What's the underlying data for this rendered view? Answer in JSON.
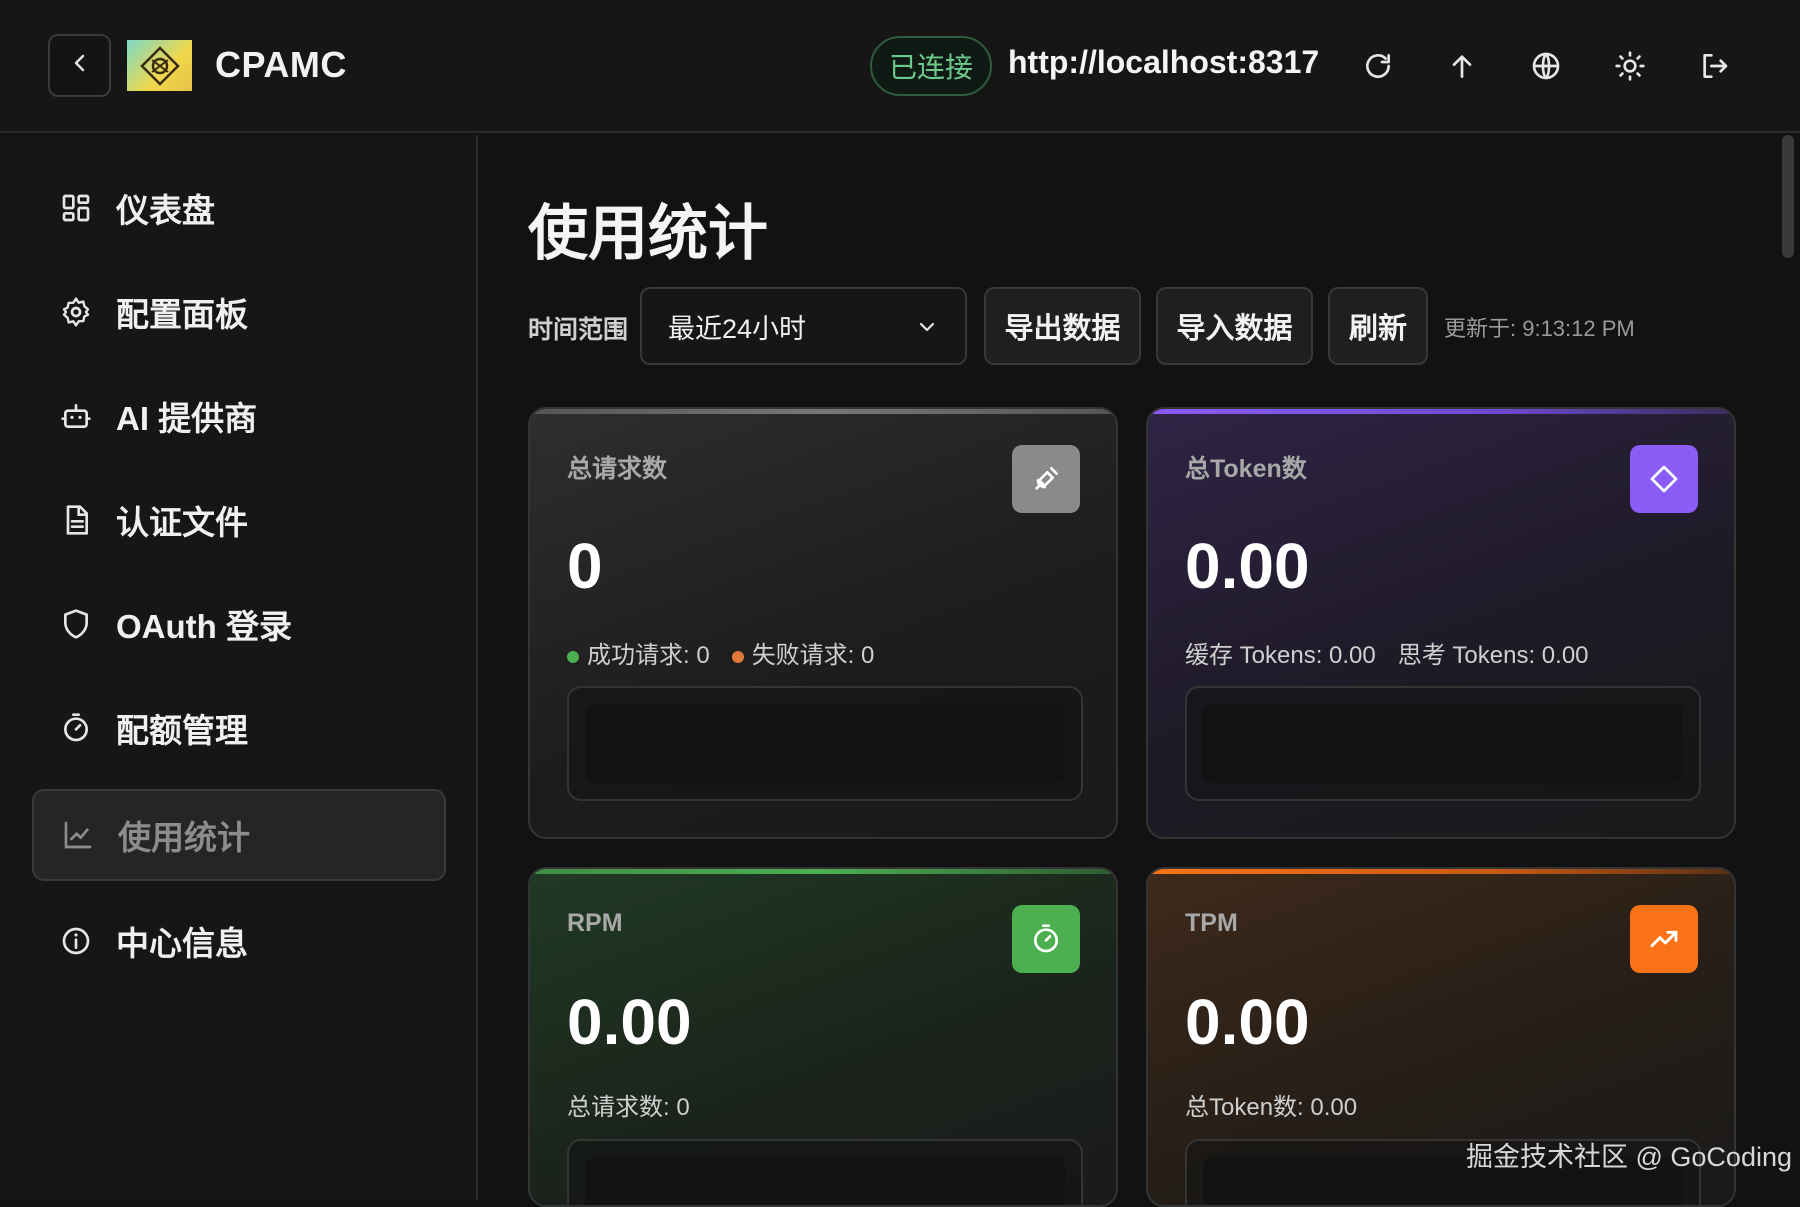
{
  "header": {
    "brand": "CPAMC",
    "connection_status": "已连接",
    "connection_url": "http://localhost:8317"
  },
  "sidebar": {
    "items": [
      {
        "label": "仪表盘",
        "icon": "dashboard-icon"
      },
      {
        "label": "配置面板",
        "icon": "gear-icon"
      },
      {
        "label": "AI 提供商",
        "icon": "bot-icon"
      },
      {
        "label": "认证文件",
        "icon": "file-icon"
      },
      {
        "label": "OAuth 登录",
        "icon": "shield-icon"
      },
      {
        "label": "配额管理",
        "icon": "timer-icon"
      },
      {
        "label": "使用统计",
        "icon": "chart-line-icon",
        "active": true
      },
      {
        "label": "中心信息",
        "icon": "info-icon"
      }
    ]
  },
  "main": {
    "title": "使用统计",
    "time_range_label": "时间范围",
    "time_range_value": "最近24小时",
    "export_label": "导出数据",
    "import_label": "导入数据",
    "refresh_label": "刷新",
    "updated_text": "更新于: 9:13:12 PM"
  },
  "cards": {
    "requests": {
      "label": "总请求数",
      "value": "0",
      "success": "成功请求: 0",
      "failed": "失败请求: 0",
      "accent": "#8a8a8a"
    },
    "tokens": {
      "label": "总Token数",
      "value": "0.00",
      "cached": "缓存 Tokens: 0.00",
      "reasoning": "思考 Tokens: 0.00",
      "accent": "#8b5cf6"
    },
    "rpm": {
      "label": "RPM",
      "value": "0.00",
      "sub": "总请求数: 0",
      "accent": "#4caf50"
    },
    "tpm": {
      "label": "TPM",
      "value": "0.00",
      "sub": "总Token数: 0.00",
      "accent": "#f97316"
    }
  },
  "colors": {
    "success_dot": "#4caf50",
    "fail_dot": "#e07a3a"
  },
  "watermark": "掘金技术社区 @ GoCoding"
}
